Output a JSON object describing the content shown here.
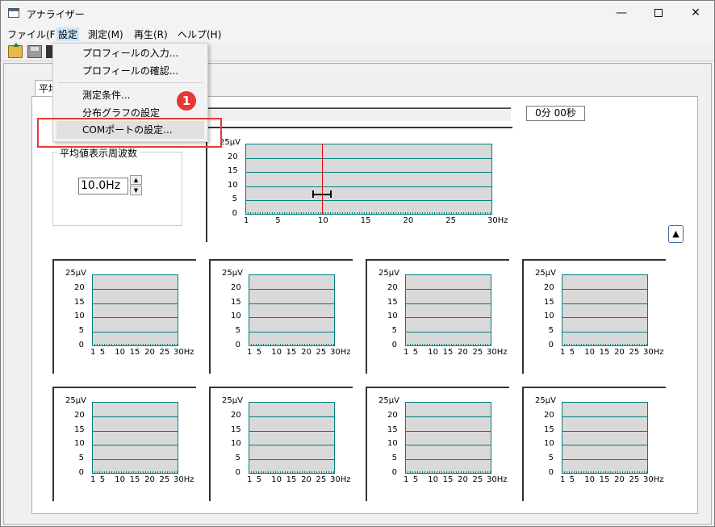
{
  "window": {
    "title": "アナライザー",
    "minimize_glyph": "—",
    "close_glyph": "✕"
  },
  "menubar": {
    "items": [
      {
        "label": "ファイル(F)"
      },
      {
        "label": "設定"
      },
      {
        "label": "測定(M)"
      },
      {
        "label": "再生(R)"
      },
      {
        "label": "ヘルプ(H)"
      }
    ],
    "active_index": 1
  },
  "toolbar": {
    "icons": [
      "open-folder-icon",
      "save-icon",
      "print-icon"
    ]
  },
  "dropdown": {
    "items": [
      {
        "label": "プロフィールの入力..."
      },
      {
        "label": "プロフィールの確認..."
      },
      {
        "label": "測定条件..."
      },
      {
        "label": "分布グラフの設定"
      },
      {
        "label": "COMポートの設定..."
      }
    ],
    "highlighted_index": 4
  },
  "annotation": {
    "badge_number": "1",
    "highlight_color": "#e53935"
  },
  "tab": {
    "label": "平均"
  },
  "timer": {
    "value": "0分 00秒"
  },
  "freq_group": {
    "title": "平均値表示周波数",
    "value": "10.0Hz"
  },
  "scroll_button": {
    "glyph": "▲"
  },
  "colors": {
    "grid_line": "#008080",
    "plot_bg": "#d9d9d9",
    "marker": "#e00000"
  },
  "chart_data": [
    {
      "type": "bar",
      "name": "main",
      "ylabel": "25μV",
      "y_ticks": [
        "25μV",
        "20",
        "15",
        "10",
        "5",
        "0"
      ],
      "x_ticks": [
        "1",
        "5",
        "10",
        "15",
        "20",
        "25",
        "30Hz"
      ],
      "xlim": [
        1,
        30
      ],
      "ylim": [
        0,
        25
      ],
      "grid": true,
      "marker_x": 10,
      "range_indicator": {
        "x_from": 9,
        "x_to": 11,
        "y": 7
      }
    },
    {
      "type": "bar",
      "y_ticks": [
        "25μV",
        "20",
        "15",
        "10",
        "5",
        "0"
      ],
      "x_ticks": [
        "1",
        "5",
        "10",
        "15",
        "20",
        "25",
        "30Hz"
      ],
      "xlim": [
        1,
        30
      ],
      "ylim": [
        0,
        25
      ],
      "grid": true
    },
    {
      "type": "bar",
      "y_ticks": [
        "25μV",
        "20",
        "15",
        "10",
        "5",
        "0"
      ],
      "x_ticks": [
        "1",
        "5",
        "10",
        "15",
        "20",
        "25",
        "30Hz"
      ],
      "xlim": [
        1,
        30
      ],
      "ylim": [
        0,
        25
      ],
      "grid": true
    },
    {
      "type": "bar",
      "y_ticks": [
        "25μV",
        "20",
        "15",
        "10",
        "5",
        "0"
      ],
      "x_ticks": [
        "1",
        "5",
        "10",
        "15",
        "20",
        "25",
        "30Hz"
      ],
      "xlim": [
        1,
        30
      ],
      "ylim": [
        0,
        25
      ],
      "grid": true
    },
    {
      "type": "bar",
      "y_ticks": [
        "25μV",
        "20",
        "15",
        "10",
        "5",
        "0"
      ],
      "x_ticks": [
        "1",
        "5",
        "10",
        "15",
        "20",
        "25",
        "30Hz"
      ],
      "xlim": [
        1,
        30
      ],
      "ylim": [
        0,
        25
      ],
      "grid": true
    },
    {
      "type": "bar",
      "y_ticks": [
        "25μV",
        "20",
        "15",
        "10",
        "5",
        "0"
      ],
      "x_ticks": [
        "1",
        "5",
        "10",
        "15",
        "20",
        "25",
        "30Hz"
      ],
      "xlim": [
        1,
        30
      ],
      "ylim": [
        0,
        25
      ],
      "grid": true
    },
    {
      "type": "bar",
      "y_ticks": [
        "25μV",
        "20",
        "15",
        "10",
        "5",
        "0"
      ],
      "x_ticks": [
        "1",
        "5",
        "10",
        "15",
        "20",
        "25",
        "30Hz"
      ],
      "xlim": [
        1,
        30
      ],
      "ylim": [
        0,
        25
      ],
      "grid": true
    },
    {
      "type": "bar",
      "y_ticks": [
        "25μV",
        "20",
        "15",
        "10",
        "5",
        "0"
      ],
      "x_ticks": [
        "1",
        "5",
        "10",
        "15",
        "20",
        "25",
        "30Hz"
      ],
      "xlim": [
        1,
        30
      ],
      "ylim": [
        0,
        25
      ],
      "grid": true
    },
    {
      "type": "bar",
      "y_ticks": [
        "25μV",
        "20",
        "15",
        "10",
        "5",
        "0"
      ],
      "x_ticks": [
        "1",
        "5",
        "10",
        "15",
        "20",
        "25",
        "30Hz"
      ],
      "xlim": [
        1,
        30
      ],
      "ylim": [
        0,
        25
      ],
      "grid": true
    }
  ]
}
